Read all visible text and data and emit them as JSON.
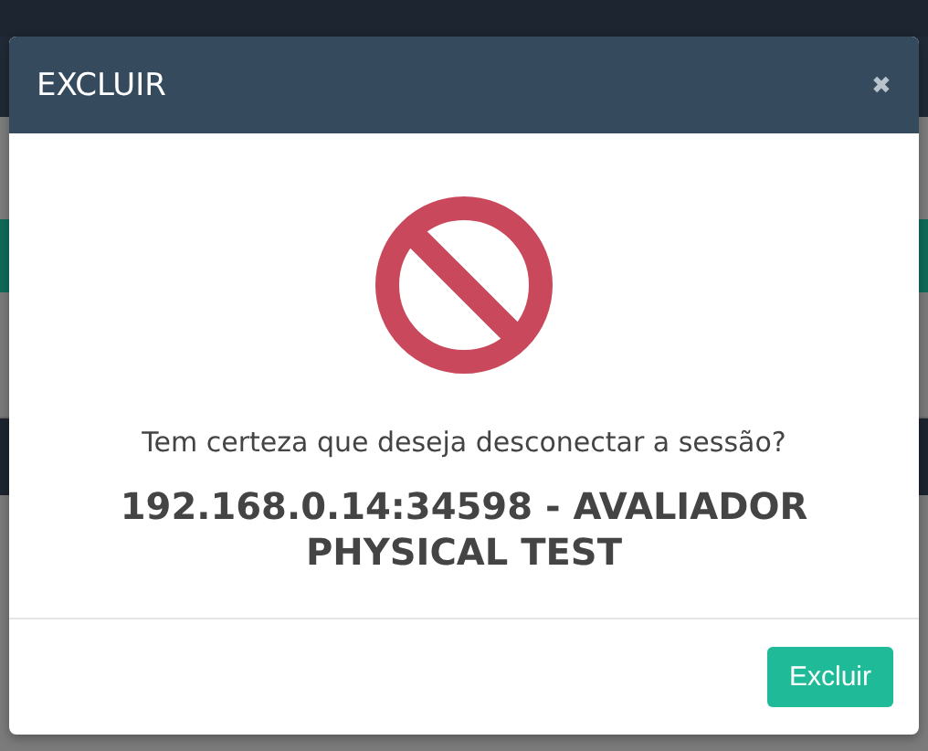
{
  "dialog": {
    "title": "EXCLUIR",
    "close": "✖",
    "message": "Tem certeza que deseja desconectar a sessão?",
    "session": "192.168.0.14:34598 - AVALIADOR PHYSICAL TEST",
    "buttons": [
      {
        "label": "Excluir",
        "kind": "primary"
      }
    ]
  }
}
